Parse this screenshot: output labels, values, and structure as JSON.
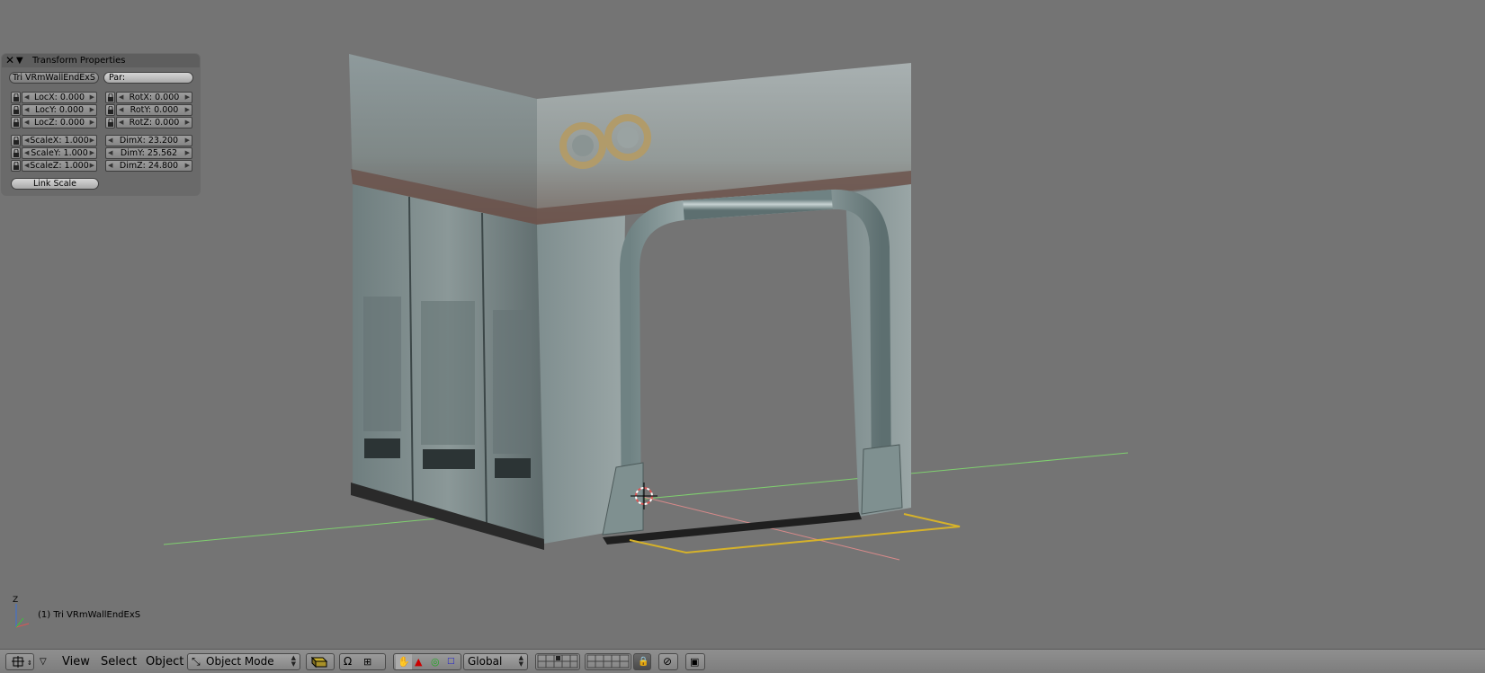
{
  "viewport": {
    "active_object_label": "(1) Tri VRmWallEndExS",
    "axis_gizmo_label": "Z"
  },
  "transform_panel": {
    "title": "Transform Properties",
    "object_name": "Tri VRmWallEndExS",
    "parent_field": "Par:",
    "loc_x": "LocX: 0.000",
    "loc_y": "LocY: 0.000",
    "loc_z": "LocZ: 0.000",
    "rot_x": "RotX: 0.000",
    "rot_y": "RotY: 0.000",
    "rot_z": "RotZ: 0.000",
    "scale_x": "ScaleX: 1.000",
    "scale_y": "ScaleY: 1.000",
    "scale_z": "ScaleZ: 1.000",
    "dim_x": "DimX: 23.200",
    "dim_y": "DimY: 25.562",
    "dim_z": "DimZ: 24.800",
    "link_scale": "Link Scale"
  },
  "header": {
    "menu_view": "View",
    "menu_select": "Select",
    "menu_object": "Object",
    "mode_select": "Object Mode",
    "orientation_select": "Global"
  },
  "colors": {
    "viewport_bg": "#747474",
    "panel_bg": "#6a6a6a",
    "header_bg": "#8a8a8a",
    "x_axis": "#d88a8a",
    "y_axis": "#7fcf6f"
  }
}
